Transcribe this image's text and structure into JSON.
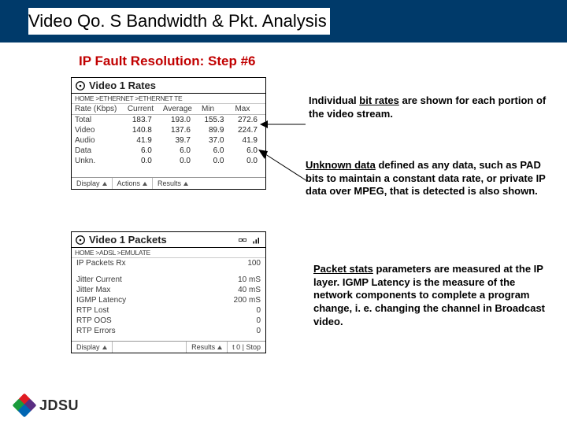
{
  "title": "Video Qo. S Bandwidth & Pkt. Analysis",
  "subtitle": "IP Fault Resolution: Step #6",
  "logo": {
    "text": "JDSU"
  },
  "panel_rates": {
    "title": "Video 1 Rates",
    "breadcrumb": "HOME >ETHERNET >ETHERNET TE",
    "table": {
      "headers": [
        "Rate (Kbps)",
        "Current",
        "Average",
        "Min",
        "Max"
      ],
      "rows": [
        {
          "label": "Total",
          "cells": [
            "183.7",
            "193.0",
            "155.3",
            "272.6"
          ]
        },
        {
          "label": "Video",
          "cells": [
            "140.8",
            "137.6",
            "89.9",
            "224.7"
          ]
        },
        {
          "label": "Audio",
          "cells": [
            "41.9",
            "39.7",
            "37.0",
            "41.9"
          ]
        },
        {
          "label": "Data",
          "cells": [
            "6.0",
            "6.0",
            "6.0",
            "6.0"
          ]
        },
        {
          "label": "Unkn.",
          "cells": [
            "0.0",
            "0.0",
            "0.0",
            "0.0"
          ]
        }
      ]
    },
    "footer": [
      "Display",
      "Actions",
      "Results"
    ]
  },
  "panel_packets": {
    "title": "Video 1 Packets",
    "breadcrumb": "HOME >ADSL >EMULATE",
    "rows": [
      {
        "label": "IP Packets Rx",
        "value": "100"
      },
      {
        "label": "Jitter Current",
        "value": "10 mS"
      },
      {
        "label": "Jitter Max",
        "value": "40 mS"
      },
      {
        "label": "IGMP Latency",
        "value": "200 mS"
      },
      {
        "label": "RTP Lost",
        "value": "0"
      },
      {
        "label": "RTP OOS",
        "value": "0"
      },
      {
        "label": "RTP Errors",
        "value": "0"
      }
    ],
    "footer": [
      "Display",
      "Results",
      "t 0 | Stop"
    ]
  },
  "annotations": {
    "a1": {
      "lead": "Individual ",
      "u": "bit rates",
      "rest": " are shown for each portion of the video stream."
    },
    "a2": {
      "u": "Unknown data",
      "rest": " defined as any data, such as PAD bits to maintain a constant data rate, or private IP data over MPEG, that is detected is also shown."
    },
    "a3": {
      "u": "Packet stats",
      "rest": " parameters are measured at the IP layer.  IGMP Latency is the measure of the network components to complete a program change, i. e. changing the channel in Broadcast video."
    }
  }
}
